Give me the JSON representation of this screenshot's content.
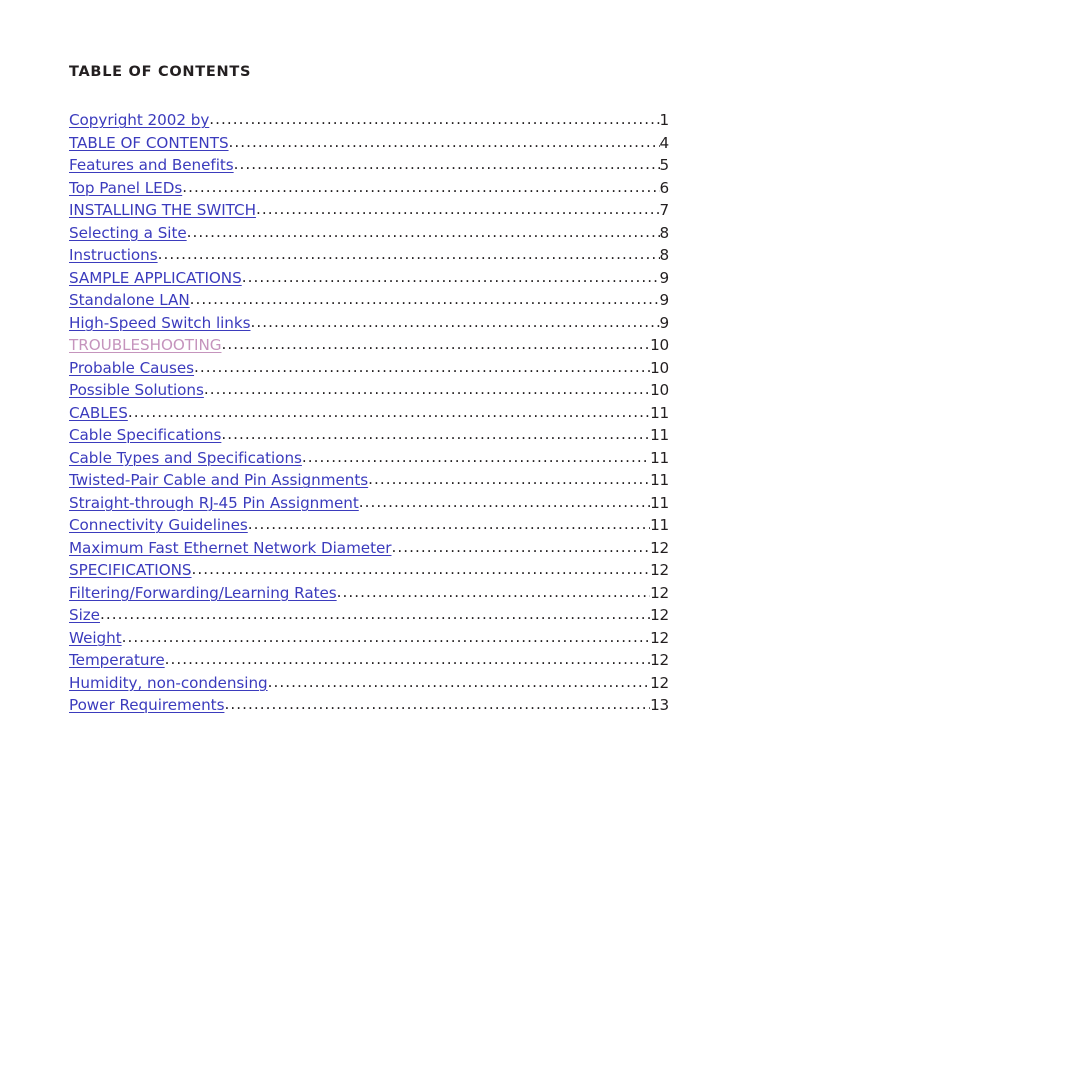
{
  "document": {
    "heading": "TABLE OF CONTENTS",
    "link_color": "#3b3bbd",
    "visited_link_color": "#c594bd",
    "text_color": "#231f20",
    "background_color": "#ffffff"
  },
  "toc": {
    "entries": [
      {
        "title": "Copyright 2002 by",
        "page": "1",
        "state": "link"
      },
      {
        "title": "TABLE OF CONTENTS",
        "page": "4",
        "state": "link"
      },
      {
        "title": "Features and Benefits",
        "page": "5",
        "state": "link"
      },
      {
        "title": "Top Panel LEDs",
        "page": "6",
        "state": "link"
      },
      {
        "title": "INSTALLING THE SWITCH",
        "page": "7",
        "state": "link"
      },
      {
        "title": "Selecting a Site",
        "page": "8",
        "state": "link"
      },
      {
        "title": "Instructions",
        "page": "8",
        "state": "link"
      },
      {
        "title": "SAMPLE APPLICATIONS",
        "page": "9",
        "state": "link"
      },
      {
        "title": "Standalone LAN",
        "page": "9",
        "state": "link"
      },
      {
        "title": "High-Speed Switch links",
        "page": "9",
        "state": "link"
      },
      {
        "title": "TROUBLESHOOTING",
        "page": "10",
        "state": "visited"
      },
      {
        "title": "Probable Causes",
        "page": "10",
        "state": "link"
      },
      {
        "title": "Possible Solutions",
        "page": "10",
        "state": "link"
      },
      {
        "title": "CABLES",
        "page": "11",
        "state": "link"
      },
      {
        "title": "Cable Specifications",
        "page": "11",
        "state": "link"
      },
      {
        "title": "Cable Types and Specifications",
        "page": "11",
        "state": "link"
      },
      {
        "title": "Twisted-Pair Cable and Pin Assignments",
        "page": "11",
        "state": "link"
      },
      {
        "title": "Straight-through RJ-45 Pin Assignment",
        "page": "11",
        "state": "link"
      },
      {
        "title": "Connectivity Guidelines",
        "page": "11",
        "state": "link"
      },
      {
        "title": "Maximum Fast Ethernet Network Diameter",
        "page": "12",
        "state": "link"
      },
      {
        "title": "SPECIFICATIONS",
        "page": "12",
        "state": "link"
      },
      {
        "title": "Filtering/Forwarding/Learning Rates",
        "page": "12",
        "state": "link"
      },
      {
        "title": "Size",
        "page": "12",
        "state": "link"
      },
      {
        "title": "Weight",
        "page": "12",
        "state": "link"
      },
      {
        "title": "Temperature",
        "page": "12",
        "state": "link"
      },
      {
        "title": "Humidity, non-condensing",
        "page": "12",
        "state": "link"
      },
      {
        "title": "Power Requirements",
        "page": "13",
        "state": "link"
      }
    ]
  }
}
